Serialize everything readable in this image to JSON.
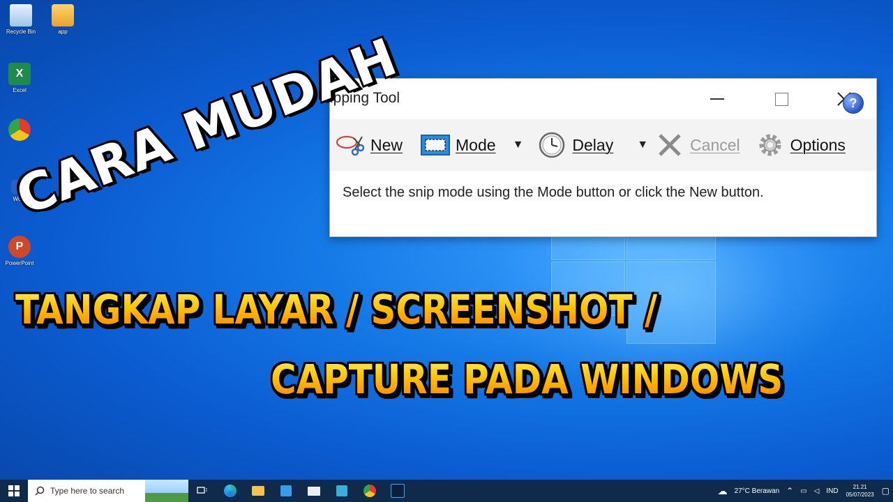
{
  "desktop": {
    "icons": [
      {
        "label": "Recycle Bin",
        "icon": "recycle-bin-icon"
      },
      {
        "label": "app",
        "icon": "folder-icon"
      },
      {
        "label": "Excel",
        "icon": "excel-icon",
        "glyph": "X"
      },
      {
        "label": "Word",
        "icon": "word-icon"
      },
      {
        "label": "PowerPoint",
        "icon": "powerpoint-icon",
        "glyph": "P"
      }
    ]
  },
  "overlay": {
    "line1": "CARA MUDAH",
    "line2": "TANGKAP LAYAR / SCREENSHOT /",
    "line3": "CAPTURE PADA WINDOWS"
  },
  "snipping_tool": {
    "title": "ipping Tool",
    "toolbar": {
      "new_label": "New",
      "mode_label": "Mode",
      "delay_label": "Delay",
      "cancel_label": "Cancel",
      "options_label": "Options"
    },
    "message": "Select the snip mode using the Mode button or click the New button.",
    "help_glyph": "?"
  },
  "taskbar": {
    "search_placeholder": "Type here to search",
    "weather": "27°C  Berawan",
    "language": "IND",
    "time": "21.21",
    "date": "05/07/2023"
  },
  "colors": {
    "accent": "#0b5bd0",
    "taskbar": "#0f2a4a",
    "title_yellow": "#ffc400",
    "title_orange": "#ff7a00"
  }
}
